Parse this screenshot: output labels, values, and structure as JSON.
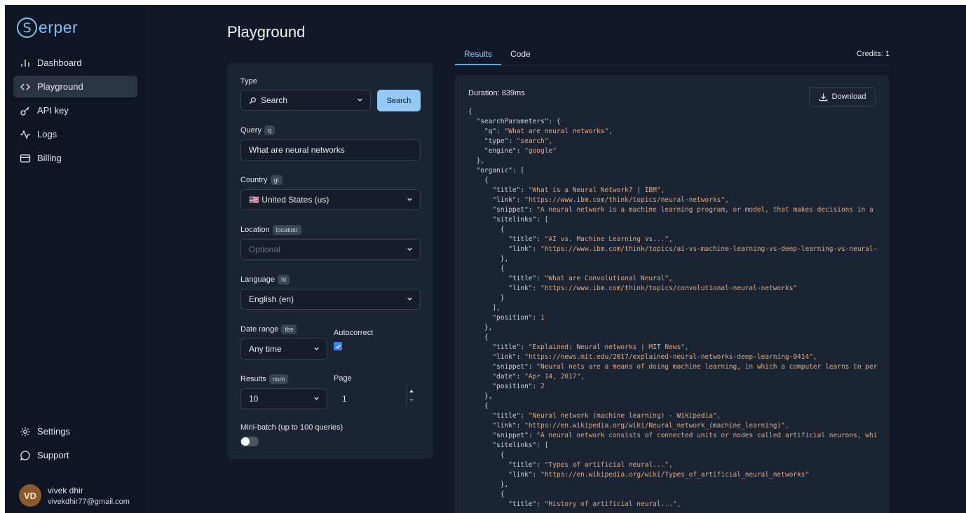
{
  "brand": {
    "logo_letter": "S",
    "logo_rest": "erper"
  },
  "sidebar": {
    "items": [
      {
        "label": "Dashboard",
        "icon": "bar-chart-icon"
      },
      {
        "label": "Playground",
        "icon": "code-brackets-icon",
        "active": true
      },
      {
        "label": "API key",
        "icon": "key-icon"
      },
      {
        "label": "Logs",
        "icon": "activity-icon"
      },
      {
        "label": "Billing",
        "icon": "credit-card-icon"
      }
    ],
    "bottom_items": [
      {
        "label": "Settings",
        "icon": "gear-icon"
      },
      {
        "label": "Support",
        "icon": "chat-bubble-icon"
      }
    ],
    "user": {
      "initials": "VD",
      "name": "vivek dhir",
      "email": "vivekdhir77@gmail.com"
    }
  },
  "page": {
    "title": "Playground"
  },
  "form": {
    "type_label": "Type",
    "type_value": "Search",
    "type_icon": "magnifier-icon",
    "search_button": "Search",
    "query_label": "Query",
    "query_tag": "q",
    "query_value": "What are neural networks",
    "country_label": "Country",
    "country_tag": "gl",
    "country_value": "🇺🇸 United States (us)",
    "location_label": "Location",
    "location_tag": "location",
    "location_placeholder": "Optional",
    "language_label": "Language",
    "language_tag": "hl",
    "language_value": "English (en)",
    "date_label": "Date range",
    "date_tag": "tbs",
    "date_value": "Any time",
    "autocorrect_label": "Autocorrect",
    "autocorrect_checked": true,
    "results_label": "Results",
    "results_tag": "num",
    "results_value": "10",
    "page_label": "Page",
    "page_value": "1",
    "minibatch_label": "Mini-batch (up to 100 queries)",
    "minibatch_on": false
  },
  "results": {
    "tabs": [
      "Results",
      "Code"
    ],
    "active_tab": "Results",
    "credits": "Credits: 1",
    "duration": "Duration: 839ms",
    "download_label": "Download",
    "code_lines": [
      "{",
      "  \"searchParameters\": {",
      "    \"q\": \"What are neural networks\",",
      "    \"type\": \"search\",",
      "    \"engine\": \"google\"",
      "  },",
      "  \"organic\": [",
      "    {",
      "      \"title\": \"What is a Neural Network? | IBM\",",
      "      \"link\": \"https://www.ibm.com/think/topics/neural-networks\",",
      "      \"snippet\": \"A neural network is a machine learning program, or model, that makes decisions in a ma",
      "      \"sitelinks\": [",
      "        {",
      "          \"title\": \"AI vs. Machine Learning vs...\",",
      "          \"link\": \"https://www.ibm.com/think/topics/ai-vs-machine-learning-vs-deep-learning-vs-neural-ne",
      "        },",
      "        {",
      "          \"title\": \"What are Convolutional Neural\",",
      "          \"link\": \"https://www.ibm.com/think/topics/convolutional-neural-networks\"",
      "        }",
      "      ],",
      "      \"position\": 1",
      "    },",
      "    {",
      "      \"title\": \"Explained: Neural networks | MIT News\",",
      "      \"link\": \"https://news.mit.edu/2017/explained-neural-networks-deep-learning-0414\",",
      "      \"snippet\": \"Neural nets are a means of doing machine learning, in which a computer learns to perfo",
      "      \"date\": \"Apr 14, 2017\",",
      "      \"position\": 2",
      "    },",
      "    {",
      "      \"title\": \"Neural network (machine learning) - Wikipedia\",",
      "      \"link\": \"https://en.wikipedia.org/wiki/Neural_network_(machine_learning)\",",
      "      \"snippet\": \"A neural network consists of connected units or nodes called artificial neurons, which",
      "      \"sitelinks\": [",
      "        {",
      "          \"title\": \"Types of artificial neural...\",",
      "          \"link\": \"https://en.wikipedia.org/wiki/Types_of_artificial_neural_networks\"",
      "        },",
      "        {",
      "          \"title\": \"History of artificial neural...\","
    ]
  }
}
